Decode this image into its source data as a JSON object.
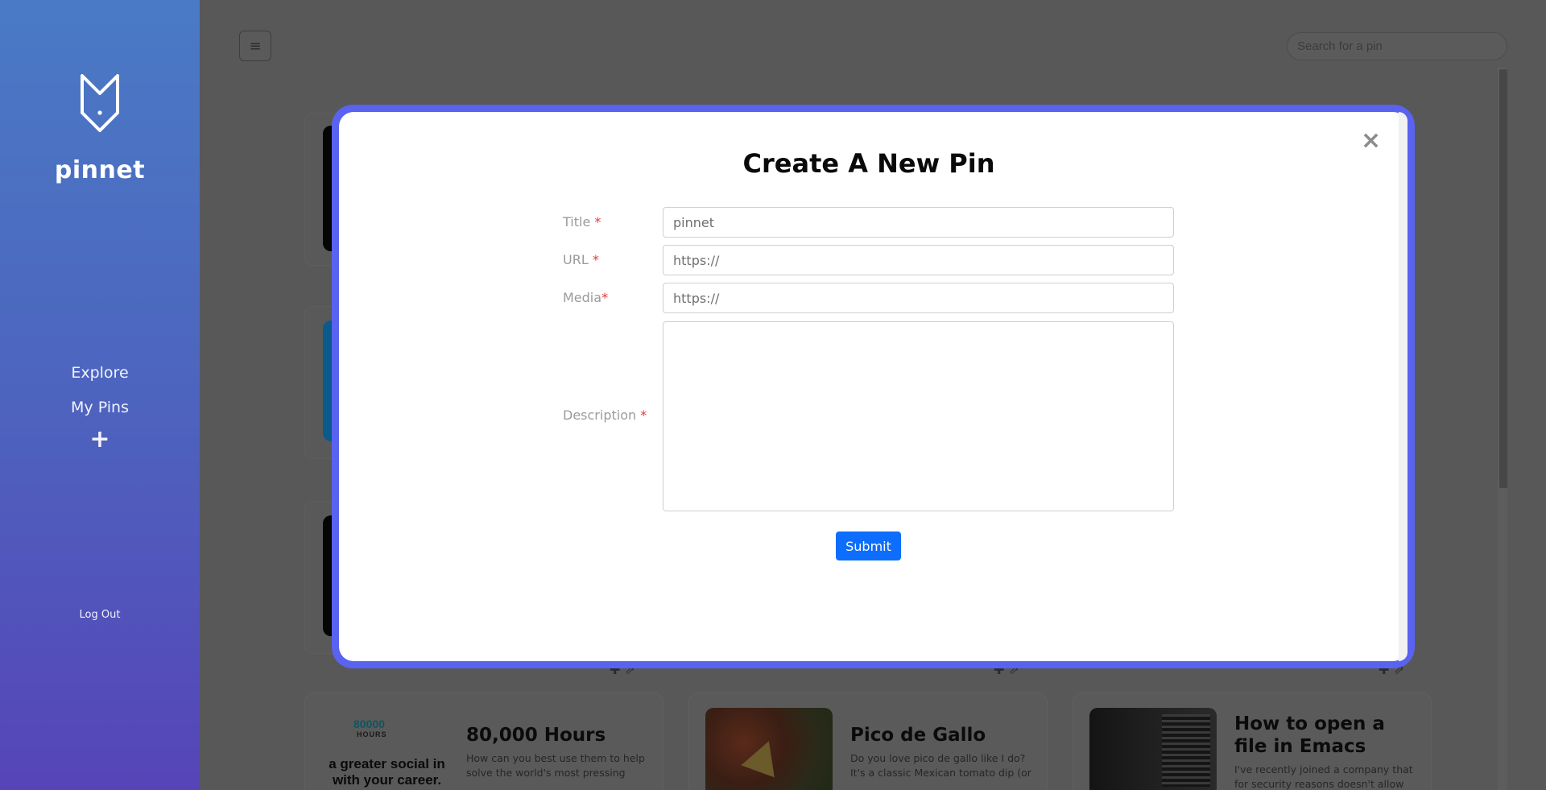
{
  "sidebar": {
    "brand": "pinnet",
    "nav": {
      "explore": "Explore",
      "my_pins": "My Pins",
      "add": "+"
    },
    "logout": "Log Out"
  },
  "header": {
    "menu_icon": "≡",
    "search_placeholder": "Search for a pin"
  },
  "cards": [
    {
      "title": "80,000 Hours",
      "description": "How can you best use them to help solve the world's most pressing",
      "thumb_logo_number": "80000",
      "thumb_logo_word": "HOURS",
      "thumb_caption": "a greater social in with your career."
    },
    {
      "title": "Pico de Gallo",
      "description": "Do you love pico de gallo like I do? It's a classic Mexican tomato dip (or"
    },
    {
      "title": "How to open a file in Emacs",
      "description": "I've recently joined a company that for security reasons doesn't allow"
    }
  ],
  "modal": {
    "title": "Create A New Pin",
    "close": "×",
    "fields": {
      "title_label": "Title",
      "title_value": "pinnet",
      "url_label": "URL",
      "url_value": "https://",
      "media_label": "Media",
      "media_value": "https://",
      "description_label": "Description",
      "description_value": ""
    },
    "required_mark": "*",
    "submit": "Submit"
  },
  "colors": {
    "accent": "#0d6efd",
    "modal_border": "#5a62f0",
    "sidebar_top": "#4a7ac6",
    "sidebar_bottom": "#5644b8"
  }
}
